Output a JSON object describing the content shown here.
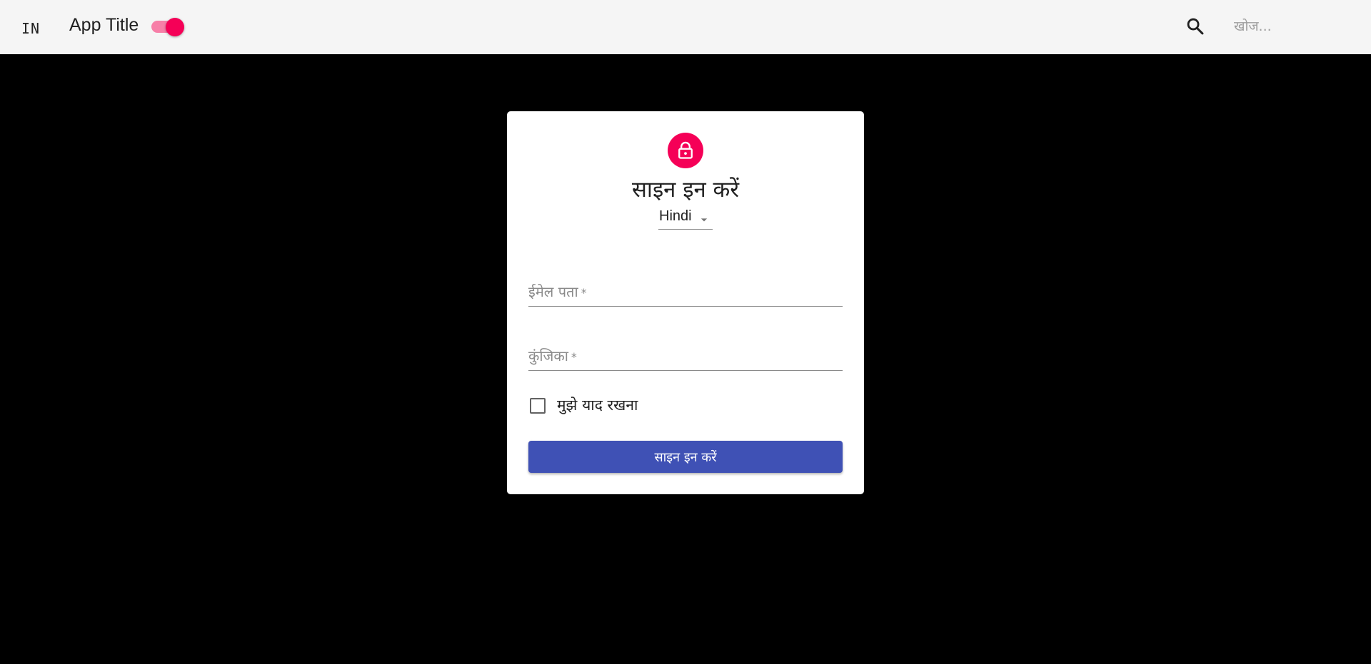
{
  "appbar": {
    "lang_code": "IN",
    "title": "App Title",
    "theme_toggle_on": true,
    "search": {
      "placeholder": "खोज..."
    }
  },
  "login_card": {
    "title": "साइन इन करें",
    "language_select": {
      "value": "Hindi"
    },
    "email_field": {
      "label": "ईमेल पता",
      "required_mark": "*",
      "value": ""
    },
    "password_field": {
      "label": "कुंजिका",
      "required_mark": "*",
      "value": ""
    },
    "remember_me": {
      "label": "मुझे याद रखना",
      "checked": false
    },
    "submit_label": "साइन इन करें"
  },
  "colors": {
    "accent": "#f50057",
    "accent_track": "#f77fa8",
    "primary": "#3f51b5",
    "appbar_bg": "#f5f5f5",
    "page_bg": "#000000"
  },
  "icons": {
    "search": "search-icon",
    "lock": "lock-icon",
    "caret": "arrow-drop-down-icon"
  }
}
